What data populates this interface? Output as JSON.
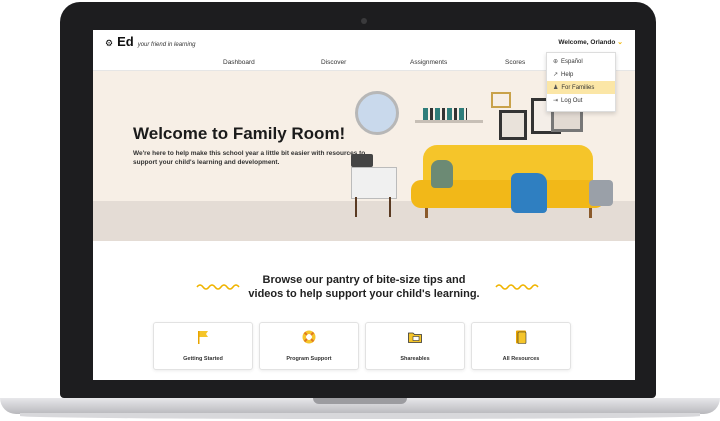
{
  "header": {
    "logo_text": "Ed",
    "tagline": "your friend in learning",
    "welcome": "Welcome, Orlando",
    "welcome_chevron": "⌄"
  },
  "nav": {
    "items": [
      "Dashboard",
      "Discover",
      "Assignments",
      "Scores"
    ]
  },
  "dropdown": {
    "items": [
      {
        "icon": "globe-icon",
        "label": "Español"
      },
      {
        "icon": "external-link-icon",
        "label": "Help"
      },
      {
        "icon": "family-icon",
        "label": "For Families"
      },
      {
        "icon": "logout-icon",
        "label": "Log Out"
      }
    ]
  },
  "hero": {
    "title": "Welcome to Family Room!",
    "subtitle": "We're here to help make this school year a little bit easier with resources to support your child's learning and development."
  },
  "pantry": {
    "line1": "Browse our pantry of bite-size tips and",
    "line2": "videos to help support your child's learning."
  },
  "cards": [
    {
      "label": "Getting Started",
      "icon": "flag-icon"
    },
    {
      "label": "Program Support",
      "icon": "lifebuoy-icon"
    },
    {
      "label": "Shareables",
      "icon": "folder-share-icon"
    },
    {
      "label": "All Resources",
      "icon": "documents-icon"
    }
  ],
  "colors": {
    "accent": "#f0b400",
    "hero_bg": "#f7efe6",
    "menu_highlight": "#fbe6a6"
  }
}
